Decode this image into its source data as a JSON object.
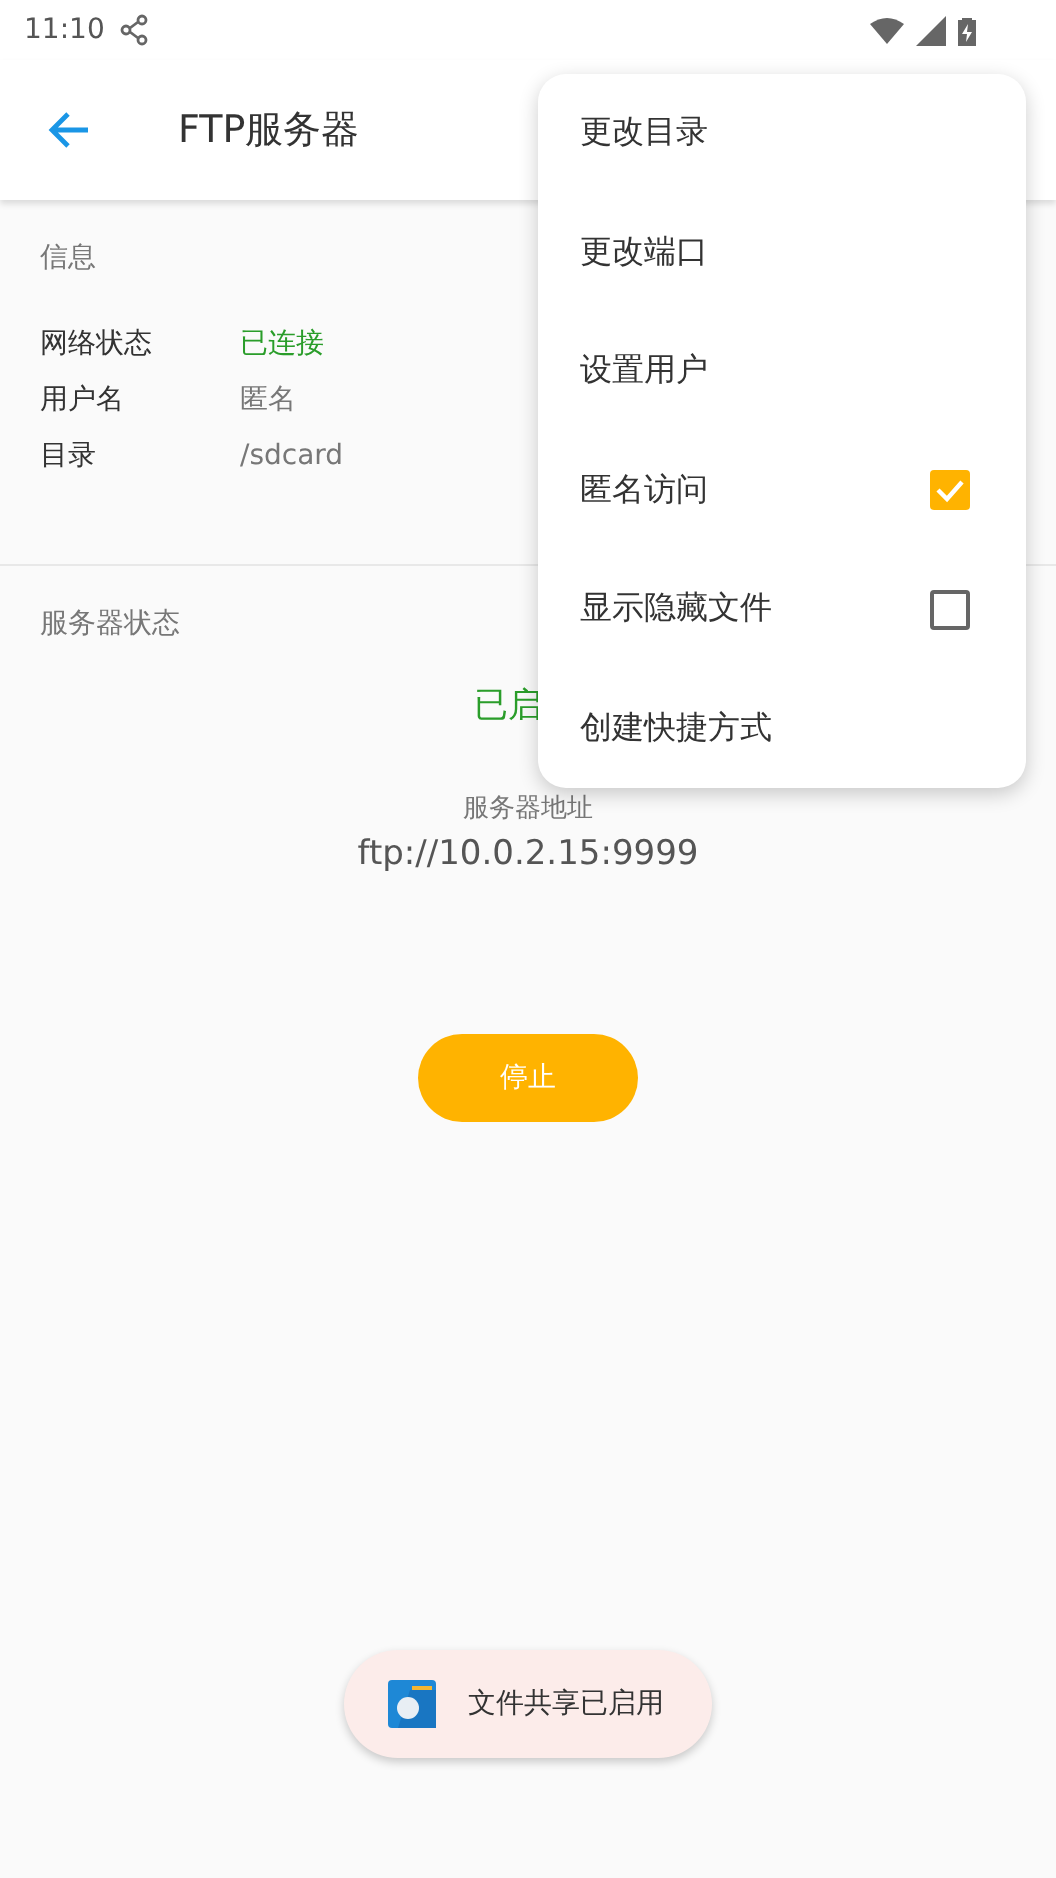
{
  "status_bar": {
    "time": "11:10"
  },
  "app_bar": {
    "title": "FTP服务器"
  },
  "info": {
    "heading": "信息",
    "rows": [
      {
        "label": "网络状态",
        "value": "已连接",
        "kind": "ok"
      },
      {
        "label": "用户名",
        "value": "匿名",
        "kind": "plain"
      },
      {
        "label": "目录",
        "value": "/sdcard",
        "kind": "plain"
      }
    ]
  },
  "server": {
    "heading": "服务器状态",
    "status": "已启",
    "address_label": "服务器地址",
    "address": "ftp://10.0.2.15:9999",
    "button": "停止"
  },
  "menu": [
    {
      "label": "更改目录",
      "kind": "plain"
    },
    {
      "label": "更改端口",
      "kind": "plain"
    },
    {
      "label": "设置用户",
      "kind": "plain"
    },
    {
      "label": "匿名访问",
      "kind": "checkbox",
      "checked": true
    },
    {
      "label": "显示隐藏文件",
      "kind": "checkbox",
      "checked": false
    },
    {
      "label": "创建快捷方式",
      "kind": "plain"
    }
  ],
  "toast": {
    "text": "文件共享已启用"
  }
}
